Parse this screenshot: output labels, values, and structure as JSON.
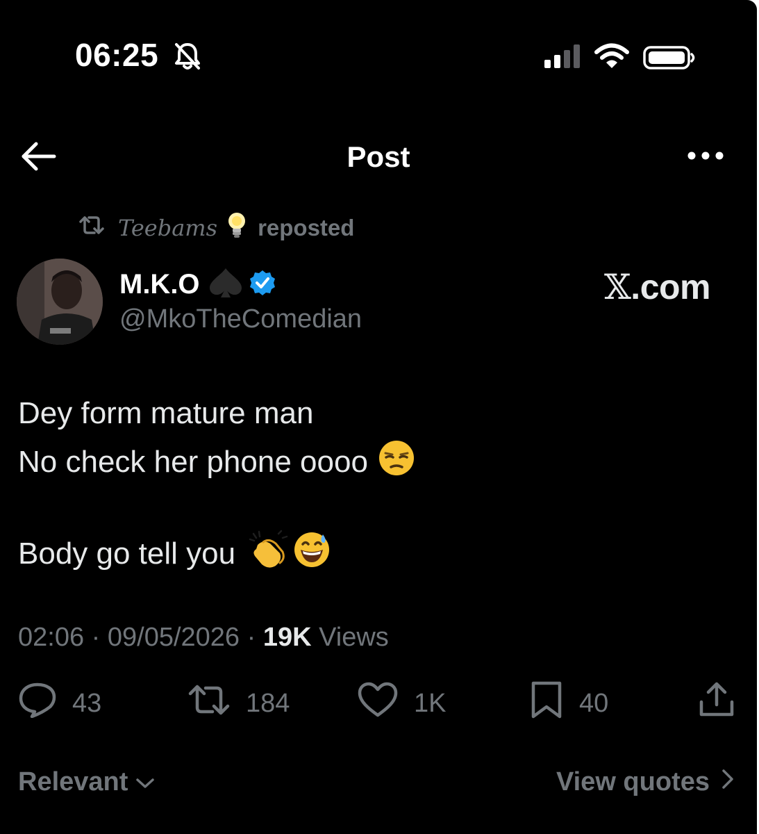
{
  "status_bar": {
    "time": "06:25",
    "icons": [
      "bell-slash-icon",
      "signal-icon",
      "wifi-icon",
      "battery-icon"
    ]
  },
  "header": {
    "title": "Post",
    "back_icon": "arrow-left-icon",
    "more_icon": "more-horizontal-icon"
  },
  "repost": {
    "name": "Teebams",
    "suffix": "reposted",
    "icon": "repost-icon"
  },
  "author": {
    "name": "M.K.O",
    "handle": "@MkoTheComedian",
    "verified": true,
    "verified_color": "#1d9bf0"
  },
  "watermark": {
    "x": "𝕏",
    "rest": ".com"
  },
  "post": {
    "line1": "Dey form mature man",
    "line2": "No check her phone oooo",
    "line3": "Body go tell you"
  },
  "meta": {
    "time": "02:06",
    "date": "09/05/2026",
    "views_count": "19K",
    "views_label": "Views"
  },
  "actions": {
    "replies": "43",
    "reposts": "184",
    "likes": "1K",
    "bookmarks": "40"
  },
  "footer": {
    "sort_label": "Relevant",
    "view_quotes": "View quotes"
  },
  "colors": {
    "background": "#000000",
    "text": "#e7e9ea",
    "muted": "#71767b",
    "accent": "#1d9bf0"
  }
}
